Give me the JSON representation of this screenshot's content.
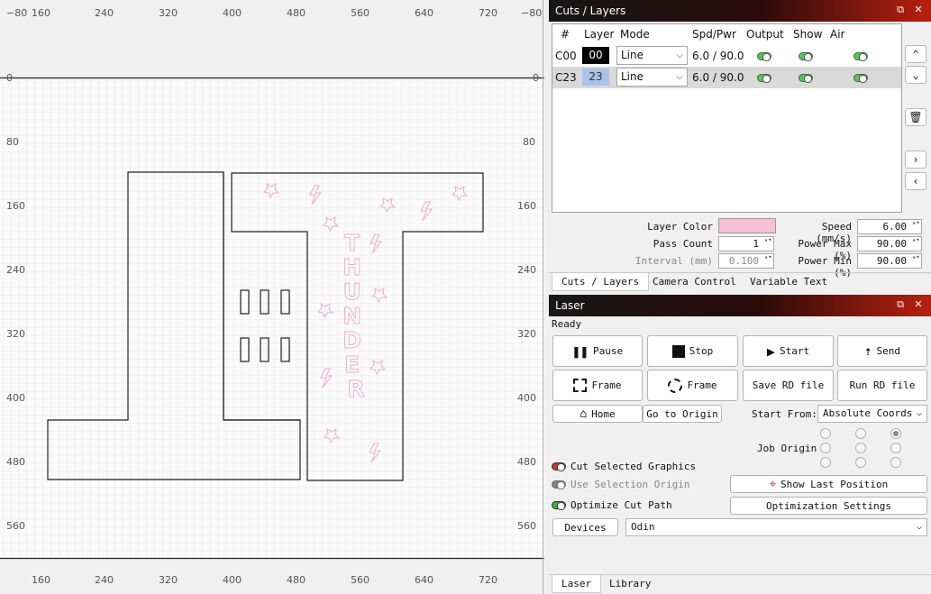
{
  "canvas": {
    "top_ticks": [
      "−80",
      "160",
      "240",
      "320",
      "400",
      "480",
      "560",
      "640",
      "720",
      "−80"
    ],
    "bottom_ticks": [
      "160",
      "240",
      "320",
      "400",
      "480",
      "560",
      "640",
      "720"
    ],
    "left_ticks": [
      "0",
      "80",
      "160",
      "240",
      "320",
      "400",
      "480",
      "560"
    ],
    "right_ticks": [
      "0",
      "80",
      "160",
      "240",
      "320",
      "400",
      "480",
      "560"
    ],
    "artwork_text": "THUNDER",
    "artwork_color": "#f5b6d3"
  },
  "cuts_panel": {
    "title": "Cuts / Layers",
    "headers": {
      "num": "#",
      "layer": "Layer",
      "mode": "Mode",
      "spdpwr": "Spd/Pwr",
      "output": "Output",
      "show": "Show",
      "air": "Air"
    },
    "rows": [
      {
        "id": "C00",
        "layer": "00",
        "mode": "Line",
        "spdpwr": "6.0 / 90.0",
        "color": "#000000",
        "text_color": "#ffffff"
      },
      {
        "id": "C23",
        "layer": "23",
        "mode": "Line",
        "spdpwr": "6.0 / 90.0",
        "color": "#a9c4e6",
        "text_color": "#333333"
      }
    ],
    "layer_color_label": "Layer Color",
    "layer_color": "#f7bfd8",
    "pass_count_label": "Pass Count",
    "pass_count": "1",
    "interval_label": "Interval (mm)",
    "interval": "0.100",
    "speed_label": "Speed (mm/s)",
    "speed": "6.00",
    "power_max_label": "Power Max (%)",
    "power_max": "90.00",
    "power_min_label": "Power Min (%)",
    "power_min": "90.00",
    "tabs": [
      "Cuts / Layers",
      "Camera Control",
      "Variable Text"
    ]
  },
  "laser_panel": {
    "title": "Laser",
    "status": "Ready",
    "buttons": {
      "pause": "Pause",
      "stop": "Stop",
      "start": "Start",
      "send": "Send",
      "frame1": "Frame",
      "frame2": "Frame",
      "save_rd": "Save RD file",
      "run_rd": "Run RD file",
      "home": "Home",
      "go_origin": "Go to Origin"
    },
    "start_from_label": "Start From:",
    "start_from_value": "Absolute Coords",
    "job_origin_label": "Job Origin",
    "cut_selected": "Cut Selected Graphics",
    "use_selection_origin": "Use Selection Origin",
    "optimize_cut_path": "Optimize Cut Path",
    "show_last_position": "Show Last Position",
    "optimization_settings": "Optimization Settings",
    "devices_label": "Devices",
    "device_value": "Odin",
    "tabs": [
      "Laser",
      "Library"
    ]
  }
}
